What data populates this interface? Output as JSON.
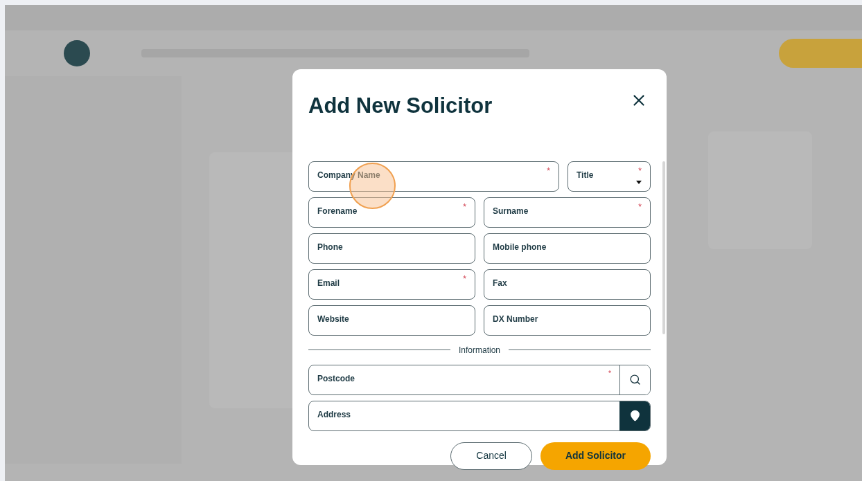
{
  "dialog": {
    "title": "Add New Solicitor",
    "rows": [
      {
        "fields": [
          {
            "label": "Company Name",
            "required_mark": "*",
            "kind": "text"
          },
          {
            "label": "Title",
            "required_mark": "*",
            "kind": "select"
          }
        ]
      },
      {
        "fields": [
          {
            "label": "Forename",
            "required_mark": "*",
            "kind": "text"
          },
          {
            "label": "Surname",
            "required_mark": "*",
            "kind": "text"
          }
        ]
      },
      {
        "fields": [
          {
            "label": "Phone",
            "kind": "text"
          },
          {
            "label": "Mobile phone",
            "kind": "text"
          }
        ]
      },
      {
        "fields": [
          {
            "label": "Email",
            "required_mark": "*",
            "kind": "text"
          },
          {
            "label": "Fax",
            "kind": "text"
          }
        ]
      },
      {
        "fields": [
          {
            "label": "Website",
            "kind": "text"
          },
          {
            "label": "DX Number",
            "kind": "text"
          }
        ]
      }
    ],
    "section_label": "Information",
    "address_fields": [
      {
        "label": "Postcode",
        "required_mark": "*",
        "kind": "search"
      },
      {
        "label": "Address",
        "kind": "map"
      }
    ],
    "buttons": [
      {
        "label": "Cancel",
        "kind": "secondary"
      },
      {
        "label": "Add Solicitor",
        "kind": "primary"
      }
    ]
  }
}
